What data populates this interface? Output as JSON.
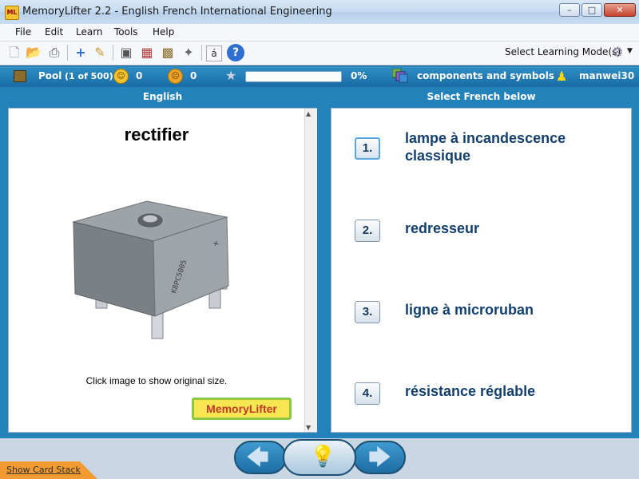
{
  "window": {
    "title": "MemoryLifter 2.2 - English French International Engineering",
    "icon_text": "ML"
  },
  "menu": [
    "File",
    "Edit",
    "Learn",
    "Tools",
    "Help"
  ],
  "toolbar": {
    "learning_mode_label": "Select Learning Mode(s)"
  },
  "status": {
    "box_label": "Pool",
    "box_position": "(1 of 500)",
    "correct_count": "0",
    "wrong_count": "0",
    "progress_text": "0%",
    "progress_fraction": 0,
    "chapter": "components and symbols",
    "user": "manwei30"
  },
  "question": {
    "column_header": "English",
    "word": "rectifier",
    "image_hint": "Click image to show original size.",
    "logo_text": "MemoryLifter",
    "image_label": "KBPC5005"
  },
  "answers": {
    "column_header": "Select French below",
    "items": [
      {
        "number": "1.",
        "text": "lampe à incandescence classique"
      },
      {
        "number": "2.",
        "text": "redresseur"
      },
      {
        "number": "3.",
        "text": "ligne à microruban"
      },
      {
        "number": "4.",
        "text": "résistance réglable"
      }
    ]
  },
  "bottom": {
    "show_card_stack": "Show Card Stack"
  },
  "colors": {
    "accent": "#2282b9",
    "answer_text": "#13406e",
    "logo_bg": "#f7e552"
  }
}
